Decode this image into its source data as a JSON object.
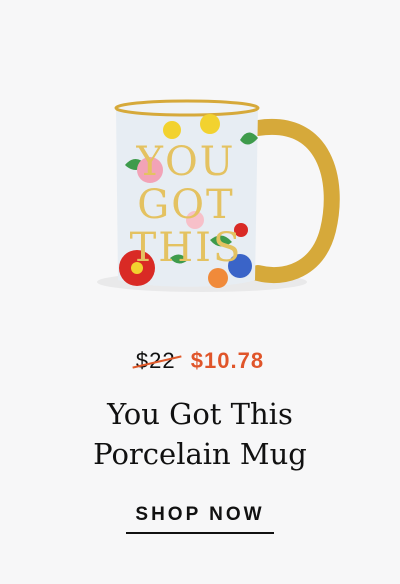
{
  "product": {
    "image_alt": "You Got This Porcelain Mug",
    "mug_text": [
      "YOU",
      "GOT",
      "THIS"
    ],
    "old_price": "$22",
    "sale_price": "$10.78",
    "title_line1": "You Got This",
    "title_line2": "Porcelain Mug",
    "cta_label": "SHOP NOW"
  },
  "colors": {
    "background": "#f7f7f8",
    "sale": "#e0552a",
    "text": "#111111",
    "gold": "#d6a93a"
  }
}
